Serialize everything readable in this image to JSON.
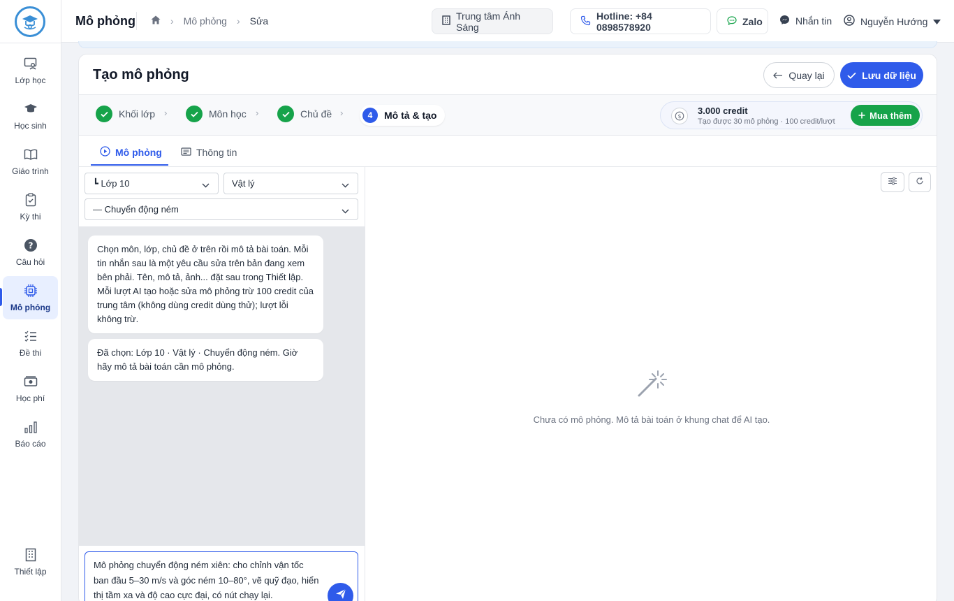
{
  "sidebar": {
    "logo_icon": "graduation-cap-globe-icon",
    "items": [
      {
        "label": "Lớp học",
        "icon": "class-board-icon"
      },
      {
        "label": "Học sinh",
        "icon": "graduation-cap-icon"
      },
      {
        "label": "Giáo trình",
        "icon": "open-book-icon"
      },
      {
        "label": "Kỳ thi",
        "icon": "clipboard-check-icon"
      },
      {
        "label": "Câu hỏi",
        "icon": "question-circle-icon"
      },
      {
        "label": "Mô phỏng",
        "icon": "chip-icon",
        "active": true
      },
      {
        "label": "Đề thi",
        "icon": "checklist-icon"
      },
      {
        "label": "Học phí",
        "icon": "money-icon"
      },
      {
        "label": "Báo cáo",
        "icon": "bar-chart-icon"
      }
    ],
    "settings_label": "Thiết lập"
  },
  "topbar": {
    "title": "Mô phỏng",
    "breadcrumb": [
      "Mô phỏng",
      "Sửa"
    ],
    "center_label": "Trung tâm Ánh Sáng",
    "hotline": "Hotline: +84 0898578920",
    "zalo": "Zalo",
    "messenger": "Nhắn tin",
    "user": "Nguyễn Hướng"
  },
  "page": {
    "title": "Tạo mô phỏng",
    "back_label": "Quay lại",
    "save_label": "Lưu dữ liệu"
  },
  "steps": [
    {
      "label": "Khối lớp",
      "done": true
    },
    {
      "label": "Môn học",
      "done": true
    },
    {
      "label": "Chủ đề",
      "done": true
    },
    {
      "label": "Mô tả & tạo",
      "number": "4",
      "current": true
    }
  ],
  "credit": {
    "amount": "3.000 credit",
    "detail": "Tạo được 30 mô phỏng · 100 credit/lượt",
    "buy_label": "Mua thêm"
  },
  "tabs": [
    "Mô phỏng",
    "Thông tin"
  ],
  "filters": {
    "grade": "┗ Lớp 10",
    "subject": "Vật lý",
    "topic": "— Chuyển động ném"
  },
  "chat": {
    "messages": [
      "Chọn môn, lớp, chủ đề ở trên rồi mô tả bài toán. Mỗi tin nhắn sau là một yêu cầu sửa trên bản đang xem bên phải. Tên, mô tả, ảnh... đặt sau trong Thiết lập. Mỗi lượt AI tạo hoặc sửa mô phỏng trừ 100 credit của trung tâm (không dùng credit dùng thử); lượt lỗi không trừ.",
      "Đã chọn: Lớp 10 · Vật lý · Chuyển động ném. Giờ hãy mô tả bài toán cần mô phỏng."
    ],
    "input_value": "Mô phỏng chuyển động ném xiên: cho chỉnh vận tốc ban đầu 5–30 m/s và góc ném 10–80°, vẽ quỹ đạo, hiển thị tầm xa và độ cao cực đại, có nút chạy lại."
  },
  "preview": {
    "empty_text": "Chưa có mô phỏng. Mô tả bài toán ở khung chat để AI tạo."
  },
  "colors": {
    "primary": "#2f5bea",
    "success": "#16a34a",
    "logo": "#3a8fd6"
  }
}
